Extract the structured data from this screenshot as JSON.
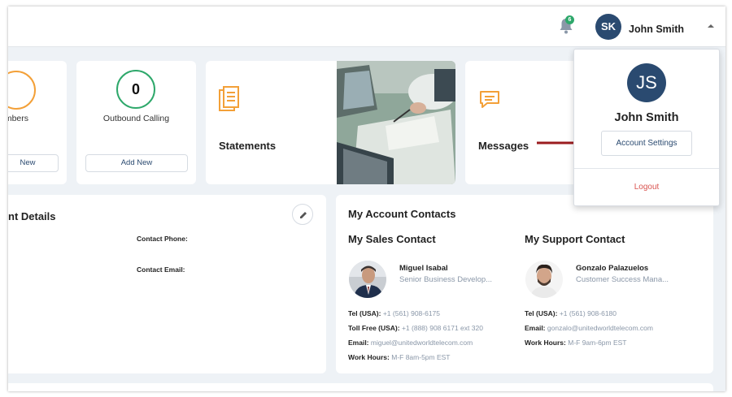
{
  "header": {
    "notification_count": "6",
    "user_initials": "SK",
    "user_name": "John Smith"
  },
  "cards": {
    "numbers_label": "umbers",
    "numbers_button": "New",
    "outbound_count": "0",
    "outbound_label": "Outbound Calling",
    "outbound_button": "Add New",
    "statements_label": "Statements",
    "messages_label": "Messages"
  },
  "details": {
    "title": "nt Details",
    "contact_phone_label": "Contact Phone:",
    "contact_email_label": "Contact Email:"
  },
  "account_contacts": {
    "title": "My Account Contacts",
    "sales": {
      "heading": "My Sales Contact",
      "name": "Miguel Isabal",
      "role": "Senior Business Develop...",
      "tel_label": "Tel (USA):",
      "tel": "+1 (561) 908-6175",
      "tollfree_label": "Toll Free (USA):",
      "tollfree": "+1 (888) 908 6171 ext 320",
      "email_label": "Email:",
      "email": "miguel@unitedworldtelecom.com",
      "hours_label": "Work Hours:",
      "hours": "M-F 8am-5pm EST"
    },
    "support": {
      "heading": "My Support Contact",
      "name": "Gonzalo Palazuelos",
      "role": "Customer Success Mana...",
      "tel_label": "Tel (USA):",
      "tel": "+1 (561) 908-6180",
      "email_label": "Email:",
      "email": "gonzalo@unitedworldtelecom.com",
      "hours_label": "Work Hours:",
      "hours": "M-F 9am-6pm EST"
    }
  },
  "dropdown": {
    "initials": "JS",
    "name": "John Smith",
    "settings_button": "Account Settings",
    "logout": "Logout"
  },
  "colors": {
    "accent_green": "#2ea86b",
    "accent_orange": "#f3a038",
    "navy": "#2a4a70",
    "arrow_red": "#9b1c1f",
    "logout_red": "#d9534f"
  }
}
